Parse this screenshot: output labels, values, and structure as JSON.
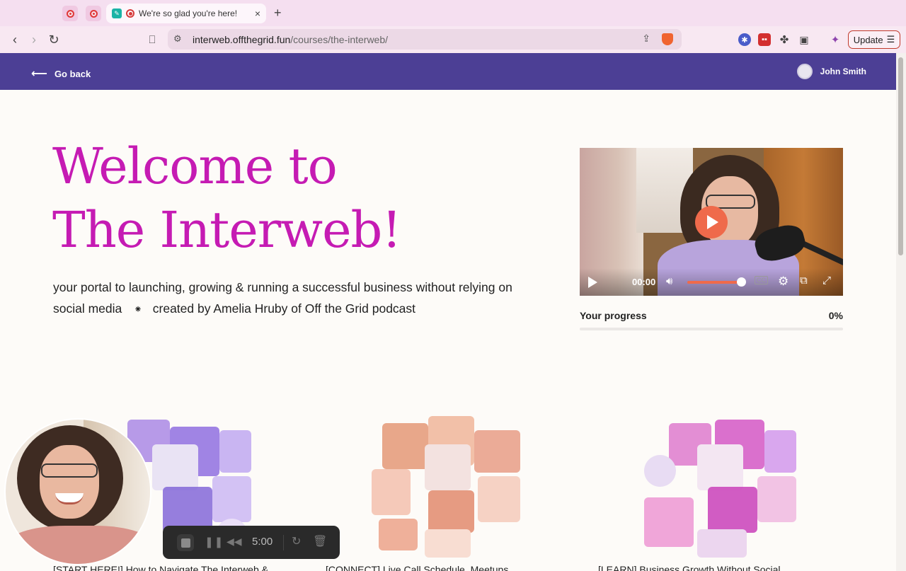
{
  "browser": {
    "tab_title": "We're so glad you're here! C",
    "tab_close": "×",
    "new_tab": "+",
    "url_domain": "interweb.offthegrid.fun",
    "url_path": "/courses/the-interweb/",
    "update_label": "Update"
  },
  "header": {
    "go_back": "Go back",
    "user_name": "John Smith"
  },
  "hero": {
    "title_line1": "Welcome to",
    "title_line2": "The Interweb!",
    "subtitle_part1": "your portal to launching, growing & running a successful business without relying on social media",
    "separator": "⁕",
    "subtitle_part2": "created by Amelia Hruby of Off the Grid podcast"
  },
  "video": {
    "time": "00:00",
    "cc": "CC"
  },
  "progress": {
    "label": "Your progress",
    "value_text": "0%",
    "value": 0
  },
  "cards": [
    {
      "title": "[START HERE!] How to Navigate The Interweb &"
    },
    {
      "title": "[CONNECT] Live Call Schedule, Meetups"
    },
    {
      "title": "[LEARN] Business Growth Without Social"
    }
  ],
  "recorder": {
    "time": "5:00"
  },
  "colors": {
    "brand_purple": "#4c3f95",
    "title_magenta": "#c51bb3",
    "video_accent": "#ef6a4b"
  }
}
